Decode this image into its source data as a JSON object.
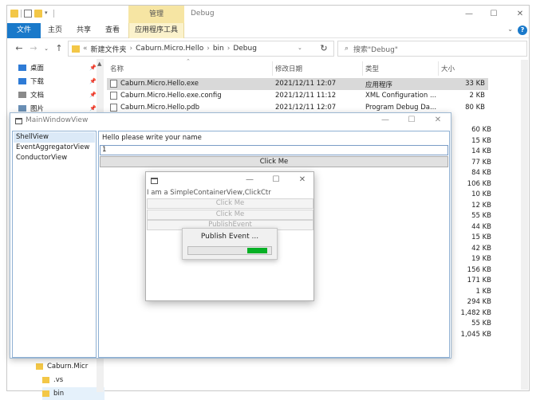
{
  "explorer": {
    "ribbon_context_tab": "管理",
    "window_title": "Debug",
    "ribbon_tabs": [
      "文件",
      "主页",
      "共享",
      "查看"
    ],
    "ribbon_tools_tab": "应用程序工具",
    "breadcrumb": [
      "新建文件夹",
      "Caburn.Micro.Hello",
      "bin",
      "Debug"
    ],
    "search_placeholder": "搜索\"Debug\"",
    "nav_items": [
      {
        "label": "桌面",
        "color": "#2e7bd6"
      },
      {
        "label": "下载",
        "color": "#2e7bd6"
      },
      {
        "label": "文档",
        "color": "#8a8a8a"
      },
      {
        "label": "图片",
        "color": "#6a8fb5"
      }
    ],
    "nav_lower": [
      {
        "label": "Caburn.Micr"
      },
      {
        "label": ".vs"
      },
      {
        "label": "bin"
      }
    ],
    "columns": {
      "name": "名称",
      "date": "修改日期",
      "type": "类型",
      "size": "大小"
    },
    "rows": [
      {
        "name": "Caburn.Micro.Hello.exe",
        "date": "2021/12/11 12:07",
        "type": "应用程序",
        "size": "33 KB",
        "selected": true
      },
      {
        "name": "Caburn.Micro.Hello.exe.config",
        "date": "2021/12/11 11:12",
        "type": "XML Configuration ...",
        "size": "2 KB",
        "selected": false
      },
      {
        "name": "Caburn.Micro.Hello.pdb",
        "date": "2021/12/11 12:07",
        "type": "Program Debug Da...",
        "size": "80 KB",
        "selected": false
      }
    ],
    "more_sizes": [
      "60 KB",
      "15 KB",
      "14 KB",
      "77 KB",
      "84 KB",
      "106 KB",
      "10 KB",
      "12 KB",
      "55 KB",
      "44 KB",
      "15 KB",
      "42 KB",
      "19 KB",
      "156 KB",
      "171 KB",
      "1 KB",
      "294 KB",
      "1,482 KB",
      "55 KB",
      "1,045 KB"
    ]
  },
  "main_window": {
    "title": "MainWindowView",
    "views": [
      {
        "label": "ShellView",
        "selected": true
      },
      {
        "label": "EventAggregatorView",
        "selected": false
      },
      {
        "label": "ConductorView",
        "selected": false
      }
    ],
    "prompt": "Hello please write your name",
    "name_value": "1",
    "click_me": "Click Me"
  },
  "child_window": {
    "info": "I am  a  SimpleContainerView,ClickCtr",
    "buttons": [
      "Click Me",
      "Click Me",
      "PublishEvent"
    ]
  },
  "progress_popup": {
    "text": "Publish Event ...",
    "progress_start": 0.71,
    "progress_end": 0.95,
    "fill_color": "#06b025"
  }
}
